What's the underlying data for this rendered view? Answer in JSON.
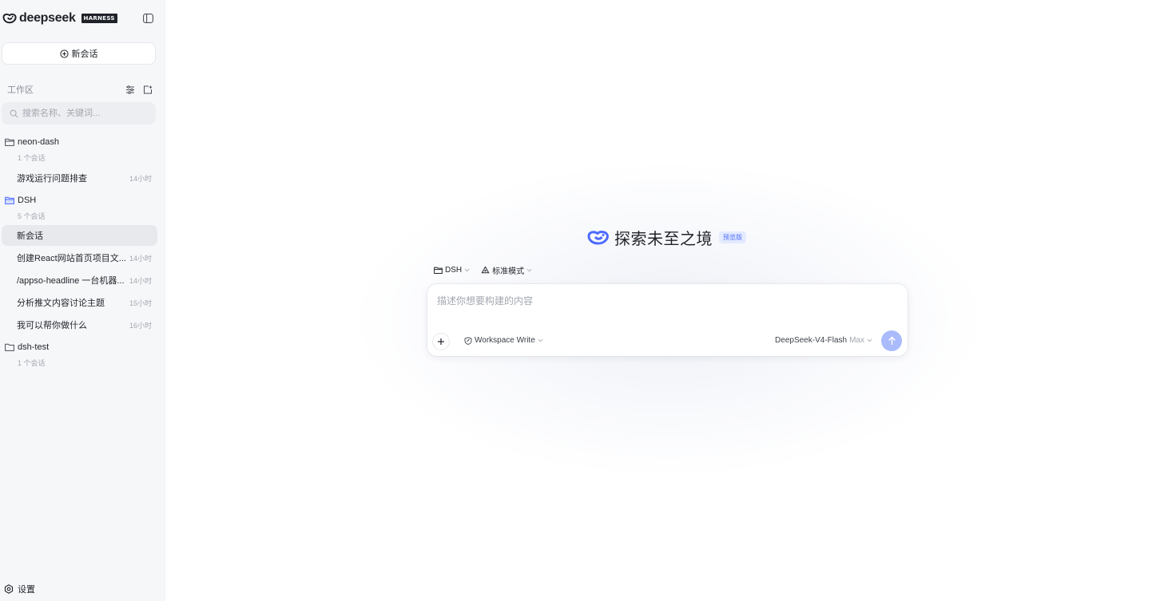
{
  "brand": {
    "name": "deepseek",
    "tag": "HARNESS"
  },
  "sidebar": {
    "new_chat": "新会话",
    "workspace_title": "工作区",
    "search": {
      "placeholder": "搜索名称、关键词..."
    },
    "folders": [
      {
        "name": "neon-dash",
        "count": "1 个会话",
        "open": false,
        "chats": [
          {
            "title": "游戏运行问题排查",
            "time": "14小时"
          }
        ]
      },
      {
        "name": "DSH",
        "count": "5 个会话",
        "open": true,
        "chats": [
          {
            "title": "新会话",
            "time": "",
            "active": true
          },
          {
            "title": "创建React网站首页项目文...",
            "time": "14小时"
          },
          {
            "title": "/appso-headline 一台机器...",
            "time": "14小时"
          },
          {
            "title": "分析推文内容讨论主题",
            "time": "15小时"
          },
          {
            "title": "我可以帮你做什么",
            "time": "16小时"
          }
        ]
      },
      {
        "name": "dsh-test",
        "count": "1 个会话",
        "open": false,
        "chats": []
      }
    ],
    "settings": "设置"
  },
  "main": {
    "hero_title": "探索未至之境",
    "hero_badge": "预览版",
    "project": "DSH",
    "mode": "标准模式",
    "composer": {
      "placeholder": "描述你想要构建的内容",
      "permission": "Workspace Write",
      "model": "DeepSeek-V4-Flash",
      "model_tier": "Max"
    }
  },
  "colors": {
    "accent": "#4d6bfe",
    "send_button": "#a9bbfb",
    "active_item": "#e8e9ed",
    "sidebar_bg": "#f6f7f9"
  }
}
